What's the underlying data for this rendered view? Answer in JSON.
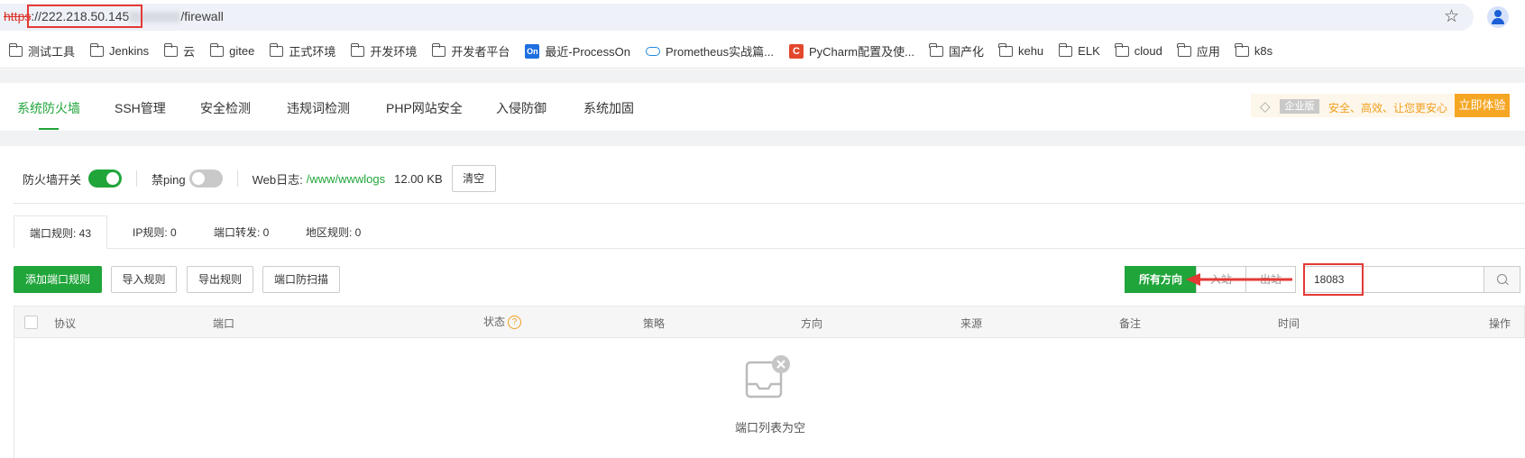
{
  "browser": {
    "url_scheme": "https",
    "url_host": "://222.218.50.145",
    "url_path": "/firewall",
    "bookmark_star_icon": "star-icon",
    "profile_icon": "person-icon"
  },
  "bookmarks": [
    {
      "label": "测试工具",
      "icon": "folder-icon"
    },
    {
      "label": "Jenkins",
      "icon": "folder-icon"
    },
    {
      "label": "云",
      "icon": "folder-icon"
    },
    {
      "label": "gitee",
      "icon": "folder-icon"
    },
    {
      "label": "正式环境",
      "icon": "folder-icon"
    },
    {
      "label": "开发环境",
      "icon": "folder-icon"
    },
    {
      "label": "开发者平台",
      "icon": "folder-icon"
    },
    {
      "label": "最近-ProcessOn",
      "icon": "processon-icon"
    },
    {
      "label": "Prometheus实战篇...",
      "icon": "cloud-icon"
    },
    {
      "label": "PyCharm配置及使...",
      "icon": "c-icon"
    },
    {
      "label": "国产化",
      "icon": "folder-icon"
    },
    {
      "label": "kehu",
      "icon": "folder-icon"
    },
    {
      "label": "ELK",
      "icon": "folder-icon"
    },
    {
      "label": "cloud",
      "icon": "folder-icon"
    },
    {
      "label": "应用",
      "icon": "folder-icon"
    },
    {
      "label": "k8s",
      "icon": "folder-icon"
    }
  ],
  "topnav": {
    "tabs": [
      "系统防火墙",
      "SSH管理",
      "安全检测",
      "违规词检测",
      "PHP网站安全",
      "入侵防御",
      "系统加固"
    ],
    "active_tab": "系统防火墙",
    "promo": {
      "badge": "企业版",
      "text": "安全、高效、让您更安心",
      "button": "立即体验"
    }
  },
  "controls": {
    "firewall_label": "防火墙开关",
    "firewall_on": true,
    "ping_label": "禁ping",
    "ping_on": false,
    "weblog_label": "Web日志:",
    "weblog_path": "/www/wwwlogs",
    "weblog_size": "12.00 KB",
    "clear_button": "清空"
  },
  "subtabs": [
    {
      "label": "端口规则: 43",
      "active": true
    },
    {
      "label": "IP规则: 0",
      "active": false
    },
    {
      "label": "端口转发: 0",
      "active": false
    },
    {
      "label": "地区规则: 0",
      "active": false
    }
  ],
  "actions": {
    "add_port_rule": "添加端口规则",
    "import_rules": "导入规则",
    "export_rules": "导出规则",
    "port_scan_protect": "端口防扫描"
  },
  "direction_filter": {
    "options": [
      "所有方向",
      "入站",
      "出站"
    ],
    "selected": "所有方向"
  },
  "search": {
    "value": "18083"
  },
  "table": {
    "columns": [
      "协议",
      "端口",
      "状态",
      "策略",
      "方向",
      "来源",
      "备注",
      "时间",
      "操作"
    ],
    "empty_text": "端口列表为空"
  },
  "colors": {
    "accent": "#20a53a",
    "highlight": "#e53935",
    "promo": "#f5a623"
  }
}
